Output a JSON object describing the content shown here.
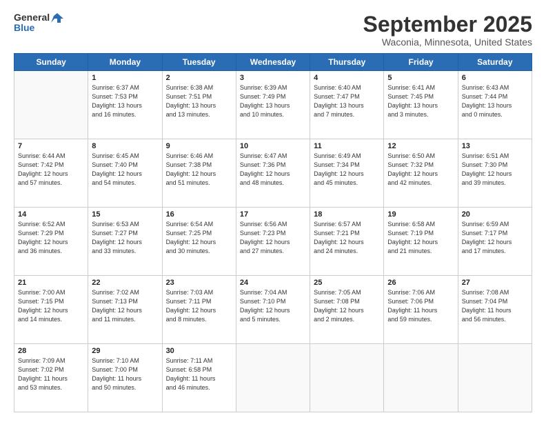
{
  "logo": {
    "line1": "General",
    "line2": "Blue"
  },
  "header": {
    "month": "September 2025",
    "location": "Waconia, Minnesota, United States"
  },
  "weekdays": [
    "Sunday",
    "Monday",
    "Tuesday",
    "Wednesday",
    "Thursday",
    "Friday",
    "Saturday"
  ],
  "weeks": [
    [
      {
        "day": "",
        "info": ""
      },
      {
        "day": "1",
        "info": "Sunrise: 6:37 AM\nSunset: 7:53 PM\nDaylight: 13 hours\nand 16 minutes."
      },
      {
        "day": "2",
        "info": "Sunrise: 6:38 AM\nSunset: 7:51 PM\nDaylight: 13 hours\nand 13 minutes."
      },
      {
        "day": "3",
        "info": "Sunrise: 6:39 AM\nSunset: 7:49 PM\nDaylight: 13 hours\nand 10 minutes."
      },
      {
        "day": "4",
        "info": "Sunrise: 6:40 AM\nSunset: 7:47 PM\nDaylight: 13 hours\nand 7 minutes."
      },
      {
        "day": "5",
        "info": "Sunrise: 6:41 AM\nSunset: 7:45 PM\nDaylight: 13 hours\nand 3 minutes."
      },
      {
        "day": "6",
        "info": "Sunrise: 6:43 AM\nSunset: 7:44 PM\nDaylight: 13 hours\nand 0 minutes."
      }
    ],
    [
      {
        "day": "7",
        "info": "Sunrise: 6:44 AM\nSunset: 7:42 PM\nDaylight: 12 hours\nand 57 minutes."
      },
      {
        "day": "8",
        "info": "Sunrise: 6:45 AM\nSunset: 7:40 PM\nDaylight: 12 hours\nand 54 minutes."
      },
      {
        "day": "9",
        "info": "Sunrise: 6:46 AM\nSunset: 7:38 PM\nDaylight: 12 hours\nand 51 minutes."
      },
      {
        "day": "10",
        "info": "Sunrise: 6:47 AM\nSunset: 7:36 PM\nDaylight: 12 hours\nand 48 minutes."
      },
      {
        "day": "11",
        "info": "Sunrise: 6:49 AM\nSunset: 7:34 PM\nDaylight: 12 hours\nand 45 minutes."
      },
      {
        "day": "12",
        "info": "Sunrise: 6:50 AM\nSunset: 7:32 PM\nDaylight: 12 hours\nand 42 minutes."
      },
      {
        "day": "13",
        "info": "Sunrise: 6:51 AM\nSunset: 7:30 PM\nDaylight: 12 hours\nand 39 minutes."
      }
    ],
    [
      {
        "day": "14",
        "info": "Sunrise: 6:52 AM\nSunset: 7:29 PM\nDaylight: 12 hours\nand 36 minutes."
      },
      {
        "day": "15",
        "info": "Sunrise: 6:53 AM\nSunset: 7:27 PM\nDaylight: 12 hours\nand 33 minutes."
      },
      {
        "day": "16",
        "info": "Sunrise: 6:54 AM\nSunset: 7:25 PM\nDaylight: 12 hours\nand 30 minutes."
      },
      {
        "day": "17",
        "info": "Sunrise: 6:56 AM\nSunset: 7:23 PM\nDaylight: 12 hours\nand 27 minutes."
      },
      {
        "day": "18",
        "info": "Sunrise: 6:57 AM\nSunset: 7:21 PM\nDaylight: 12 hours\nand 24 minutes."
      },
      {
        "day": "19",
        "info": "Sunrise: 6:58 AM\nSunset: 7:19 PM\nDaylight: 12 hours\nand 21 minutes."
      },
      {
        "day": "20",
        "info": "Sunrise: 6:59 AM\nSunset: 7:17 PM\nDaylight: 12 hours\nand 17 minutes."
      }
    ],
    [
      {
        "day": "21",
        "info": "Sunrise: 7:00 AM\nSunset: 7:15 PM\nDaylight: 12 hours\nand 14 minutes."
      },
      {
        "day": "22",
        "info": "Sunrise: 7:02 AM\nSunset: 7:13 PM\nDaylight: 12 hours\nand 11 minutes."
      },
      {
        "day": "23",
        "info": "Sunrise: 7:03 AM\nSunset: 7:11 PM\nDaylight: 12 hours\nand 8 minutes."
      },
      {
        "day": "24",
        "info": "Sunrise: 7:04 AM\nSunset: 7:10 PM\nDaylight: 12 hours\nand 5 minutes."
      },
      {
        "day": "25",
        "info": "Sunrise: 7:05 AM\nSunset: 7:08 PM\nDaylight: 12 hours\nand 2 minutes."
      },
      {
        "day": "26",
        "info": "Sunrise: 7:06 AM\nSunset: 7:06 PM\nDaylight: 11 hours\nand 59 minutes."
      },
      {
        "day": "27",
        "info": "Sunrise: 7:08 AM\nSunset: 7:04 PM\nDaylight: 11 hours\nand 56 minutes."
      }
    ],
    [
      {
        "day": "28",
        "info": "Sunrise: 7:09 AM\nSunset: 7:02 PM\nDaylight: 11 hours\nand 53 minutes."
      },
      {
        "day": "29",
        "info": "Sunrise: 7:10 AM\nSunset: 7:00 PM\nDaylight: 11 hours\nand 50 minutes."
      },
      {
        "day": "30",
        "info": "Sunrise: 7:11 AM\nSunset: 6:58 PM\nDaylight: 11 hours\nand 46 minutes."
      },
      {
        "day": "",
        "info": ""
      },
      {
        "day": "",
        "info": ""
      },
      {
        "day": "",
        "info": ""
      },
      {
        "day": "",
        "info": ""
      }
    ]
  ]
}
